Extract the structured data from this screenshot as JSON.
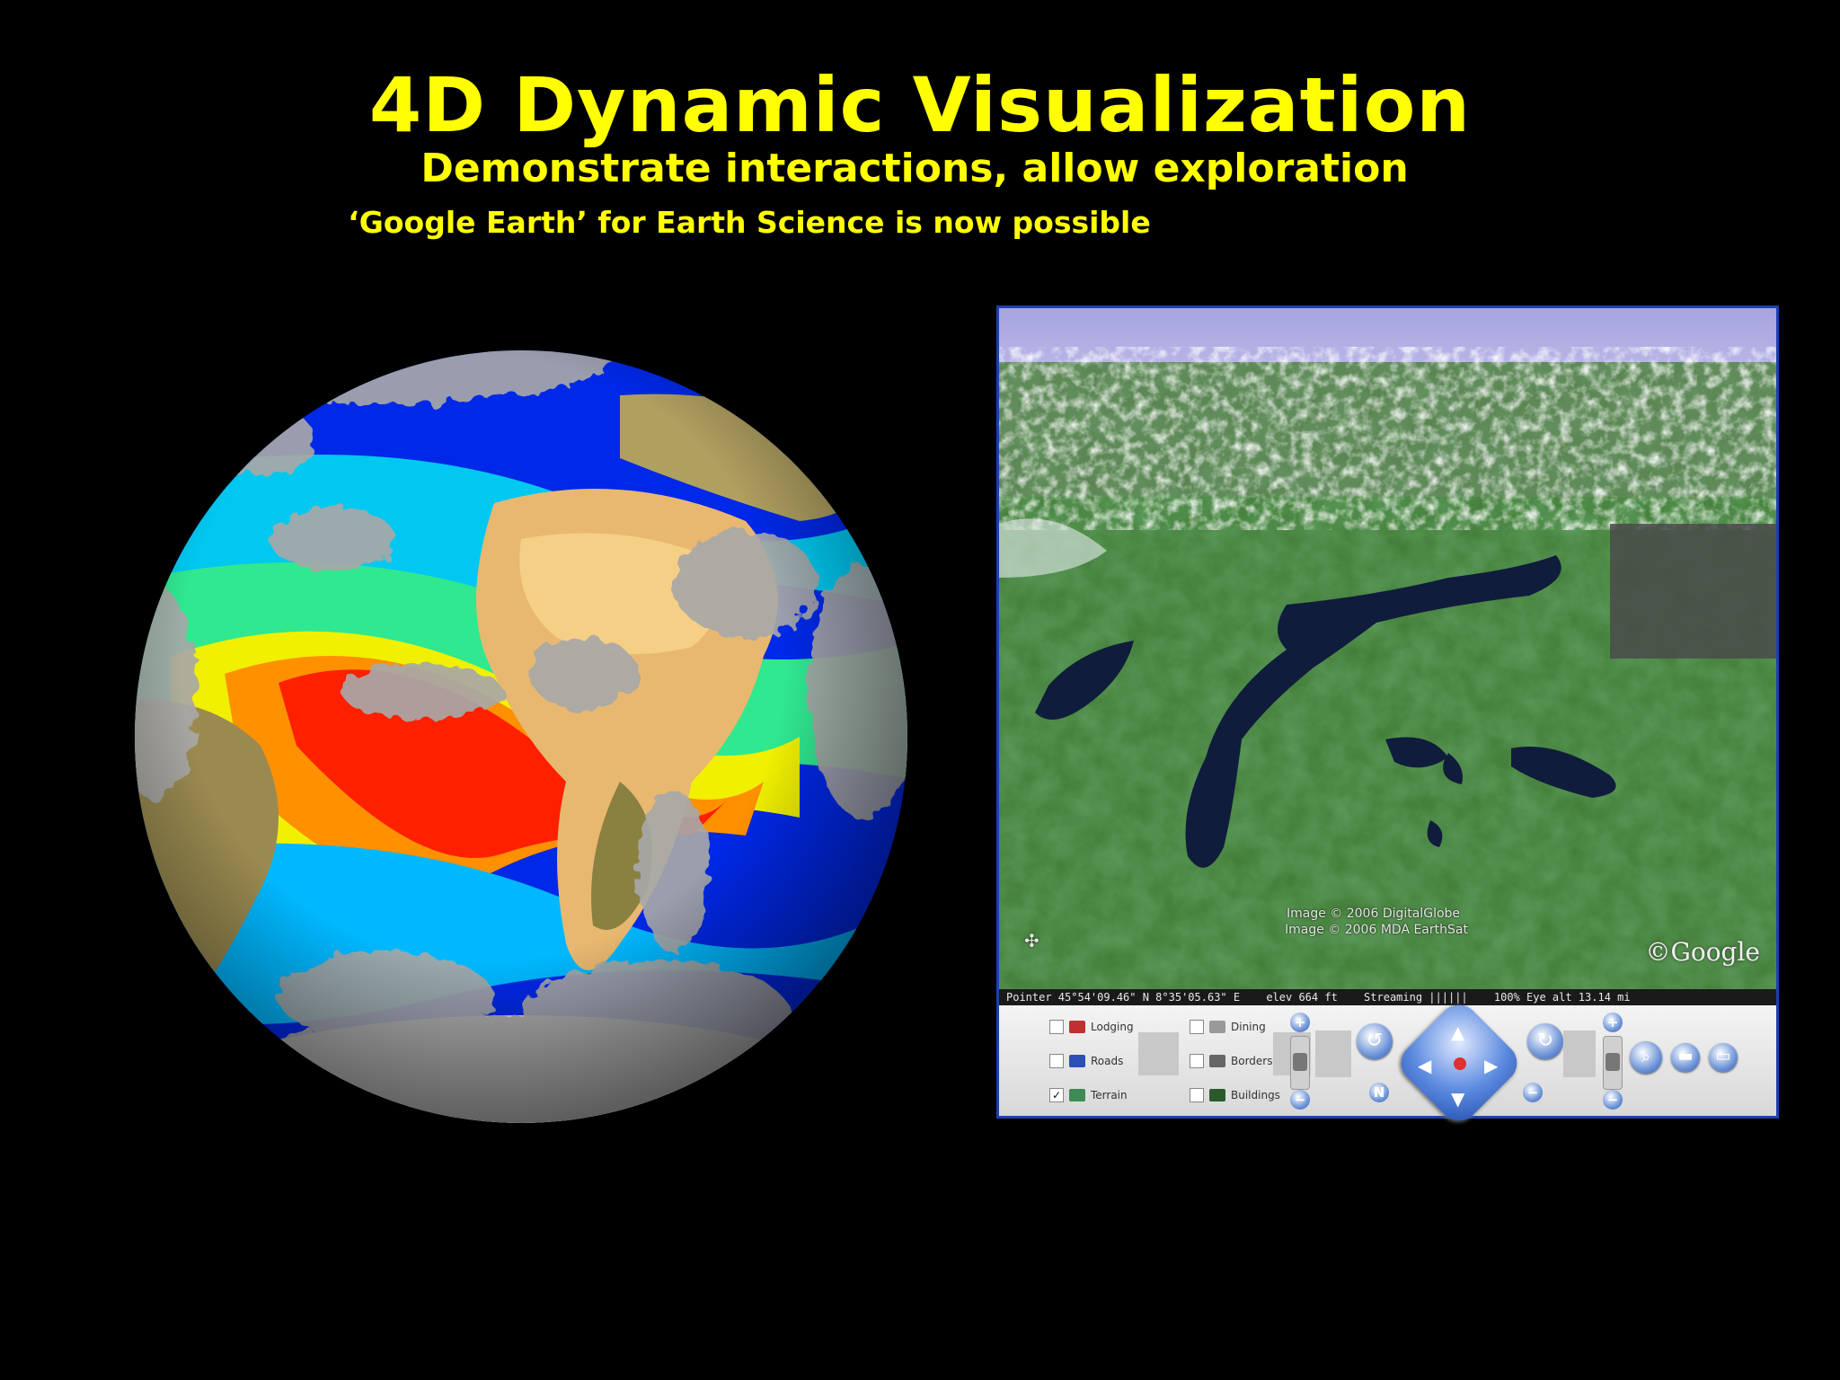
{
  "slide": {
    "title": "4D Dynamic Visualization",
    "subtitle": "Demonstrate interactions, allow exploration",
    "tagline": "‘Google Earth’ for Earth Science is now possible",
    "title_color": "#ffff00",
    "background_color": "#000000"
  },
  "google_earth": {
    "credit_line_1": "Image © 2006 DigitalGlobe",
    "credit_line_2": "Image © 2006 MDA EarthSat",
    "logo": "©Google",
    "status": {
      "pointer": "Pointer 45°54'09.46\" N   8°35'05.63\" E",
      "elevation": "elev  664 ft",
      "streaming": "Streaming ||||||",
      "eye_alt": "100% Eye alt  13.14 mi"
    },
    "layers": [
      "Lodging",
      "Roads",
      "Terrain",
      "Dining",
      "Borders",
      "Buildings"
    ],
    "layer_checked": [
      false,
      false,
      true,
      false,
      false,
      false
    ],
    "border_color": "#1c3fb3"
  },
  "globe": {
    "colors": {
      "ocean_deep": "#0020e0",
      "ocean_cool": "#00c8f0",
      "ocean_mid": "#a0f040",
      "ocean_warm": "#ff2000",
      "land": "#f0c070",
      "clouds": "#a8a8a8"
    }
  }
}
